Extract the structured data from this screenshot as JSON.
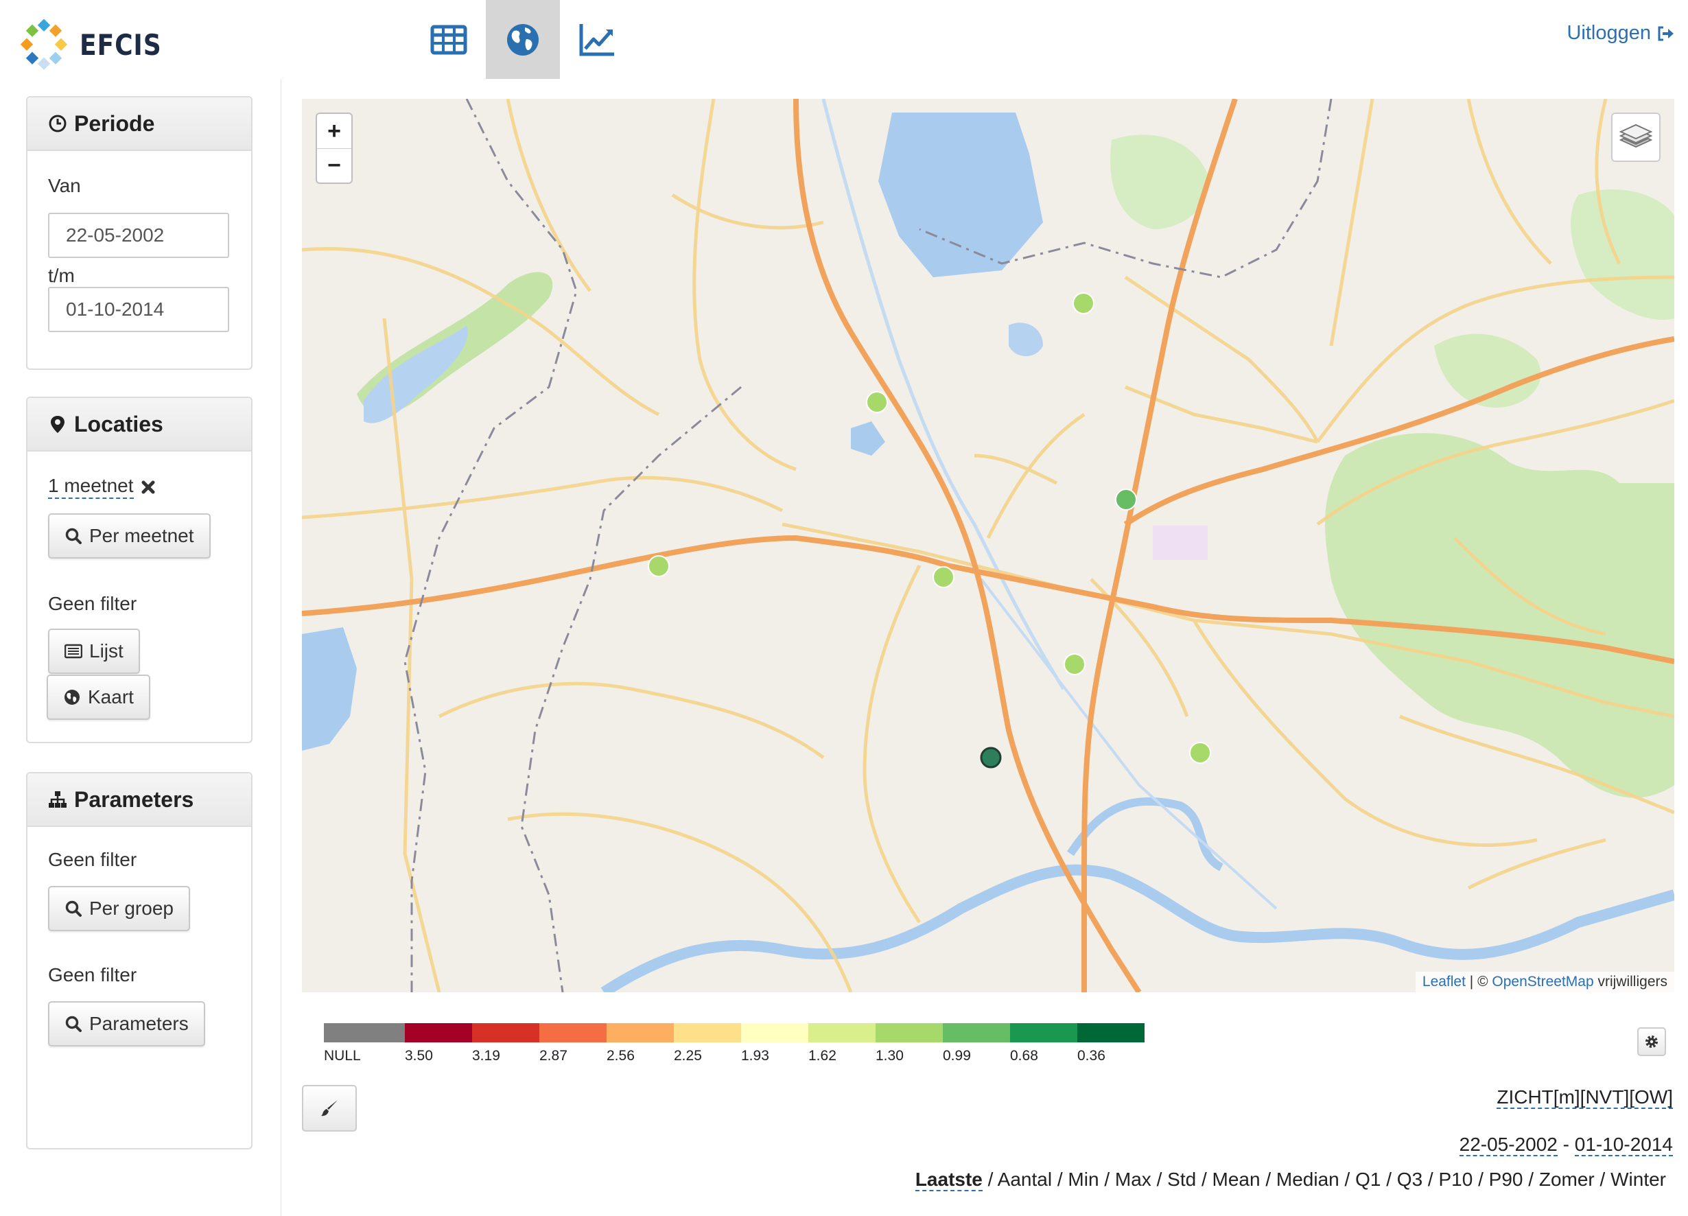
{
  "app": {
    "name": "EFCIS"
  },
  "nav": {
    "tabs": [
      {
        "name": "table-tab",
        "icon": "table-icon",
        "active": false
      },
      {
        "name": "map-tab",
        "icon": "globe-icon",
        "active": true
      },
      {
        "name": "chart-tab",
        "icon": "line-chart-icon",
        "active": false
      }
    ],
    "logout_label": "Uitloggen"
  },
  "sidebar": {
    "periode": {
      "title": "Periode",
      "van_label": "Van",
      "van_value": "22-05-2002",
      "tm_label": "t/m",
      "tm_value": "01-10-2014"
    },
    "locaties": {
      "title": "Locaties",
      "meetnet_link": "1 meetnet",
      "per_meetnet_button": "Per meetnet",
      "filter_label": "Geen filter",
      "lijst_button": "Lijst",
      "kaart_button": "Kaart"
    },
    "parameters": {
      "title": "Parameters",
      "filter_label_1": "Geen filter",
      "per_groep_button": "Per groep",
      "filter_label_2": "Geen filter",
      "parameters_button": "Parameters"
    }
  },
  "map": {
    "zoom_in": "+",
    "zoom_out": "−",
    "attribution": {
      "leaflet": "Leaflet",
      "separator": " | © ",
      "osm": "OpenStreetMap",
      "contributors": " vrijwilligers"
    },
    "markers": [
      {
        "color": "#a6d96a"
      },
      {
        "color": "#a6d96a"
      },
      {
        "color": "#66bd63"
      },
      {
        "color": "#a6d96a"
      },
      {
        "color": "#a6d96a"
      },
      {
        "color": "#a6d96a"
      },
      {
        "color": "#a6d96a"
      },
      {
        "color": "#2e7d5b"
      }
    ]
  },
  "legend": {
    "items": [
      {
        "label": "NULL",
        "color": "#808080"
      },
      {
        "label": "3.50",
        "color": "#a50026"
      },
      {
        "label": "3.19",
        "color": "#d73027"
      },
      {
        "label": "2.87",
        "color": "#f46d43"
      },
      {
        "label": "2.56",
        "color": "#fdae61"
      },
      {
        "label": "2.25",
        "color": "#fee08b"
      },
      {
        "label": "1.93",
        "color": "#ffffbf"
      },
      {
        "label": "1.62",
        "color": "#d9ef8b"
      },
      {
        "label": "1.30",
        "color": "#a6d96a"
      },
      {
        "label": "0.99",
        "color": "#66bd63"
      },
      {
        "label": "0.68",
        "color": "#1a9850"
      },
      {
        "label": "0.36",
        "color": "#006837"
      }
    ]
  },
  "info": {
    "parameter": "ZICHT[m][NVT][OW]",
    "date_from": "22-05-2002",
    "date_sep": " - ",
    "date_to": "01-10-2014"
  },
  "stats": {
    "items": [
      "Laatste",
      "Aantal",
      "Min",
      "Max",
      "Std",
      "Mean",
      "Median",
      "Q1",
      "Q3",
      "P10",
      "P90",
      "Zomer",
      "Winter"
    ],
    "active": "Laatste",
    "separator": " / "
  }
}
